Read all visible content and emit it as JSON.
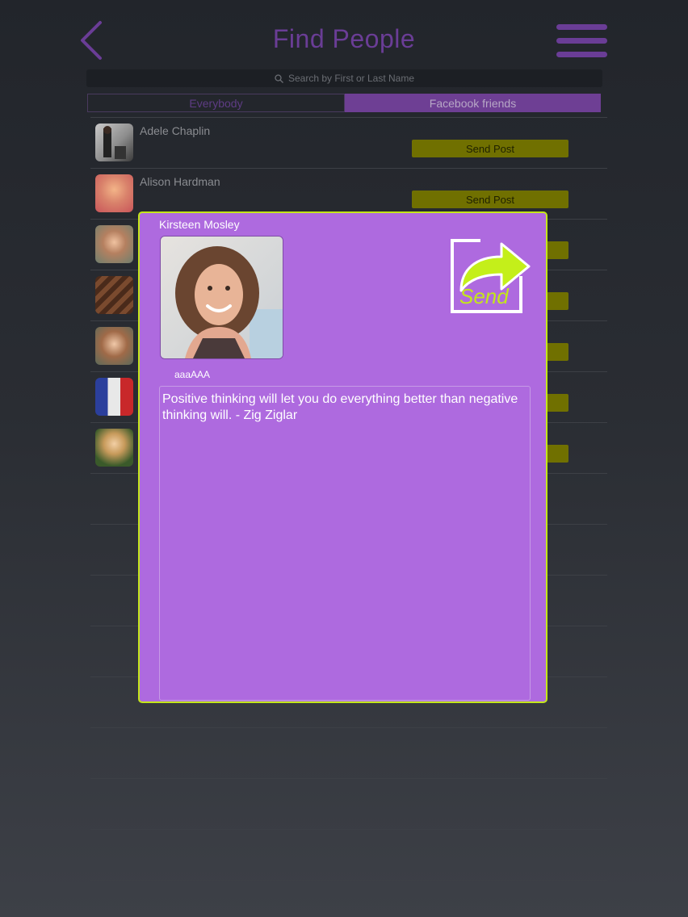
{
  "header": {
    "title": "Find People",
    "back_icon": "chevron-left-icon",
    "menu_icon": "hamburger-menu-icon"
  },
  "search": {
    "placeholder": "Search by First or Last Name"
  },
  "tabs": [
    {
      "label": "Everybody",
      "selected": false
    },
    {
      "label": "Facebook friends",
      "selected": true
    }
  ],
  "people": [
    {
      "name": "Adele Chaplin",
      "button": "Send Post"
    },
    {
      "name": "Alison Hardman",
      "button": "Send Post"
    },
    {
      "name": "",
      "button": ""
    },
    {
      "name": "",
      "button": ""
    },
    {
      "name": "",
      "button": ""
    },
    {
      "name": "",
      "button": ""
    },
    {
      "name": "",
      "button": ""
    }
  ],
  "modal": {
    "recipient_name": "Kirsteen Mosley",
    "send_label": "Send",
    "sub_label": "aaaAAA",
    "message": "Positive thinking will let you do everything better than negative thinking will. - Zig Ziglar"
  },
  "colors": {
    "accent": "#6a3d96",
    "modal_bg": "#ae6adf",
    "modal_border": "#c4e61a",
    "send_post_button": "#707000"
  }
}
